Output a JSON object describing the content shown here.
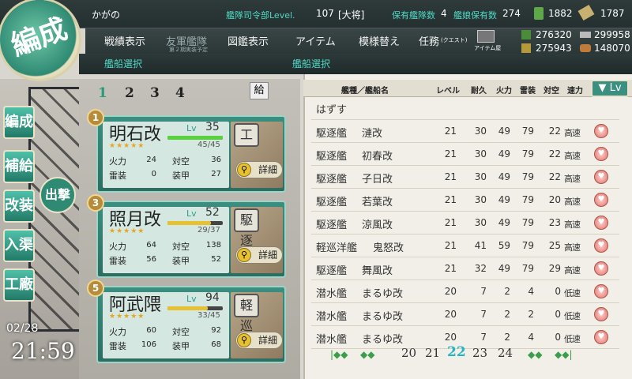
{
  "hud": {
    "player": "かがの",
    "hq_label": "艦隊司令部Level.",
    "hq_level": "107",
    "rank": "[大将]",
    "fleet_count_label": "保有艦隊数",
    "fleet_count": "4",
    "ship_count_label": "艦娘保有数",
    "ship_count": "274",
    "buckets": "1882",
    "dev_mats": "1787",
    "fuel": "276320",
    "steel": "299958",
    "ammo": "275943",
    "bauxite": "148070"
  },
  "menu": {
    "items": [
      "戦績表示",
      "友軍艦隊",
      "図鑑表示",
      "アイテム",
      "模様替え",
      "任務"
    ],
    "quest_sub": "(クエスト)",
    "friend_sub": "第２期実装予定",
    "item_shop": "アイテム屋"
  },
  "subbar": {
    "left_title": "艦船選択",
    "right_title": "艦船選択"
  },
  "emblem": "編成",
  "side_buttons": [
    "編成",
    "補給",
    "改装",
    "入渠",
    "工廠"
  ],
  "sortie_label": "出撃",
  "datetime": {
    "date": "02/28",
    "time": "21:59"
  },
  "fleet_tabs": [
    "1",
    "2",
    "3",
    "4"
  ],
  "fleet_tab_extra": "給",
  "ship_cards": [
    {
      "num": "1",
      "name": "明石改",
      "lv_label": "Lv",
      "lv": "35",
      "hp": "45/45",
      "hp_frac": 1.0,
      "stats": [
        [
          "火力",
          "24"
        ],
        [
          "対空",
          "36"
        ],
        [
          "雷装",
          "0"
        ],
        [
          "装甲",
          "27"
        ]
      ],
      "type": "工",
      "detail": "詳細"
    },
    {
      "num": "3",
      "name": "照月改",
      "lv_label": "Lv",
      "lv": "52",
      "hp": "29/37",
      "hp_frac": 0.78,
      "stats": [
        [
          "火力",
          "64"
        ],
        [
          "対空",
          "138"
        ],
        [
          "雷装",
          "56"
        ],
        [
          "装甲",
          "52"
        ]
      ],
      "type": "駆逐",
      "detail": "詳細"
    },
    {
      "num": "5",
      "name": "阿武隈",
      "lv_label": "Lv",
      "lv": "94",
      "hp": "33/45",
      "hp_frac": 0.73,
      "stats": [
        [
          "火力",
          "60"
        ],
        [
          "対空",
          "92"
        ],
        [
          "雷装",
          "106"
        ],
        [
          "装甲",
          "68"
        ]
      ],
      "type": "軽巡",
      "detail": "詳細"
    }
  ],
  "list": {
    "headers": [
      "艦種／艦船名",
      "レベル",
      "耐久",
      "火力",
      "雷装",
      "対空",
      "速力"
    ],
    "sort": "Lv",
    "remove": "はずす",
    "rows": [
      [
        "駆逐艦",
        "漣改",
        "21",
        "30",
        "49",
        "79",
        "22",
        "高速"
      ],
      [
        "駆逐艦",
        "初春改",
        "21",
        "30",
        "49",
        "79",
        "22",
        "高速"
      ],
      [
        "駆逐艦",
        "子日改",
        "21",
        "30",
        "49",
        "79",
        "22",
        "高速"
      ],
      [
        "駆逐艦",
        "若葉改",
        "21",
        "30",
        "49",
        "79",
        "20",
        "高速"
      ],
      [
        "駆逐艦",
        "涼風改",
        "21",
        "30",
        "49",
        "79",
        "23",
        "高速"
      ],
      [
        "軽巡洋艦",
        "鬼怒改",
        "21",
        "41",
        "59",
        "79",
        "25",
        "高速"
      ],
      [
        "駆逐艦",
        "舞風改",
        "21",
        "32",
        "49",
        "79",
        "29",
        "高速"
      ],
      [
        "潜水艦",
        "まるゆ改",
        "20",
        "7",
        "2",
        "4",
        "0",
        "低速"
      ],
      [
        "潜水艦",
        "まるゆ改",
        "20",
        "7",
        "2",
        "2",
        "0",
        "低速"
      ],
      [
        "潜水艦",
        "まるゆ改",
        "20",
        "7",
        "2",
        "4",
        "0",
        "低速"
      ]
    ],
    "pages": [
      "20",
      "21",
      "22",
      "23",
      "24"
    ],
    "current_page": "22"
  }
}
